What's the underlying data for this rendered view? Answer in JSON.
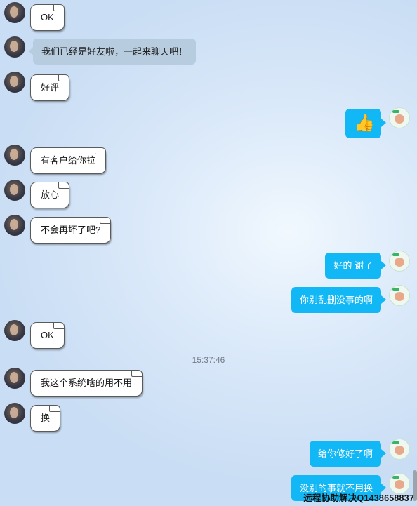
{
  "messages": {
    "m1": "OK",
    "m2": "我们已经是好友啦，一起来聊天吧！",
    "m3": "好评",
    "m4": "👍",
    "m5": "有客户给你拉",
    "m6": "放心",
    "m7": "不会再坏了吧?",
    "m8": "好的 谢了",
    "m9": "你别乱删没事的啊",
    "m10": "OK",
    "m11": "我这个系统啥的用不用",
    "m12": "换",
    "m13": "给你修好了啊",
    "m14": "没别的事就不用换"
  },
  "timestamp": "15:37:46",
  "watermark": "远程协助解决Q1438658837",
  "colors": {
    "outgoing_bubble": "#12b7f5",
    "system_bubble": "#b8cce0",
    "incoming_bubble": "#ffffff"
  }
}
